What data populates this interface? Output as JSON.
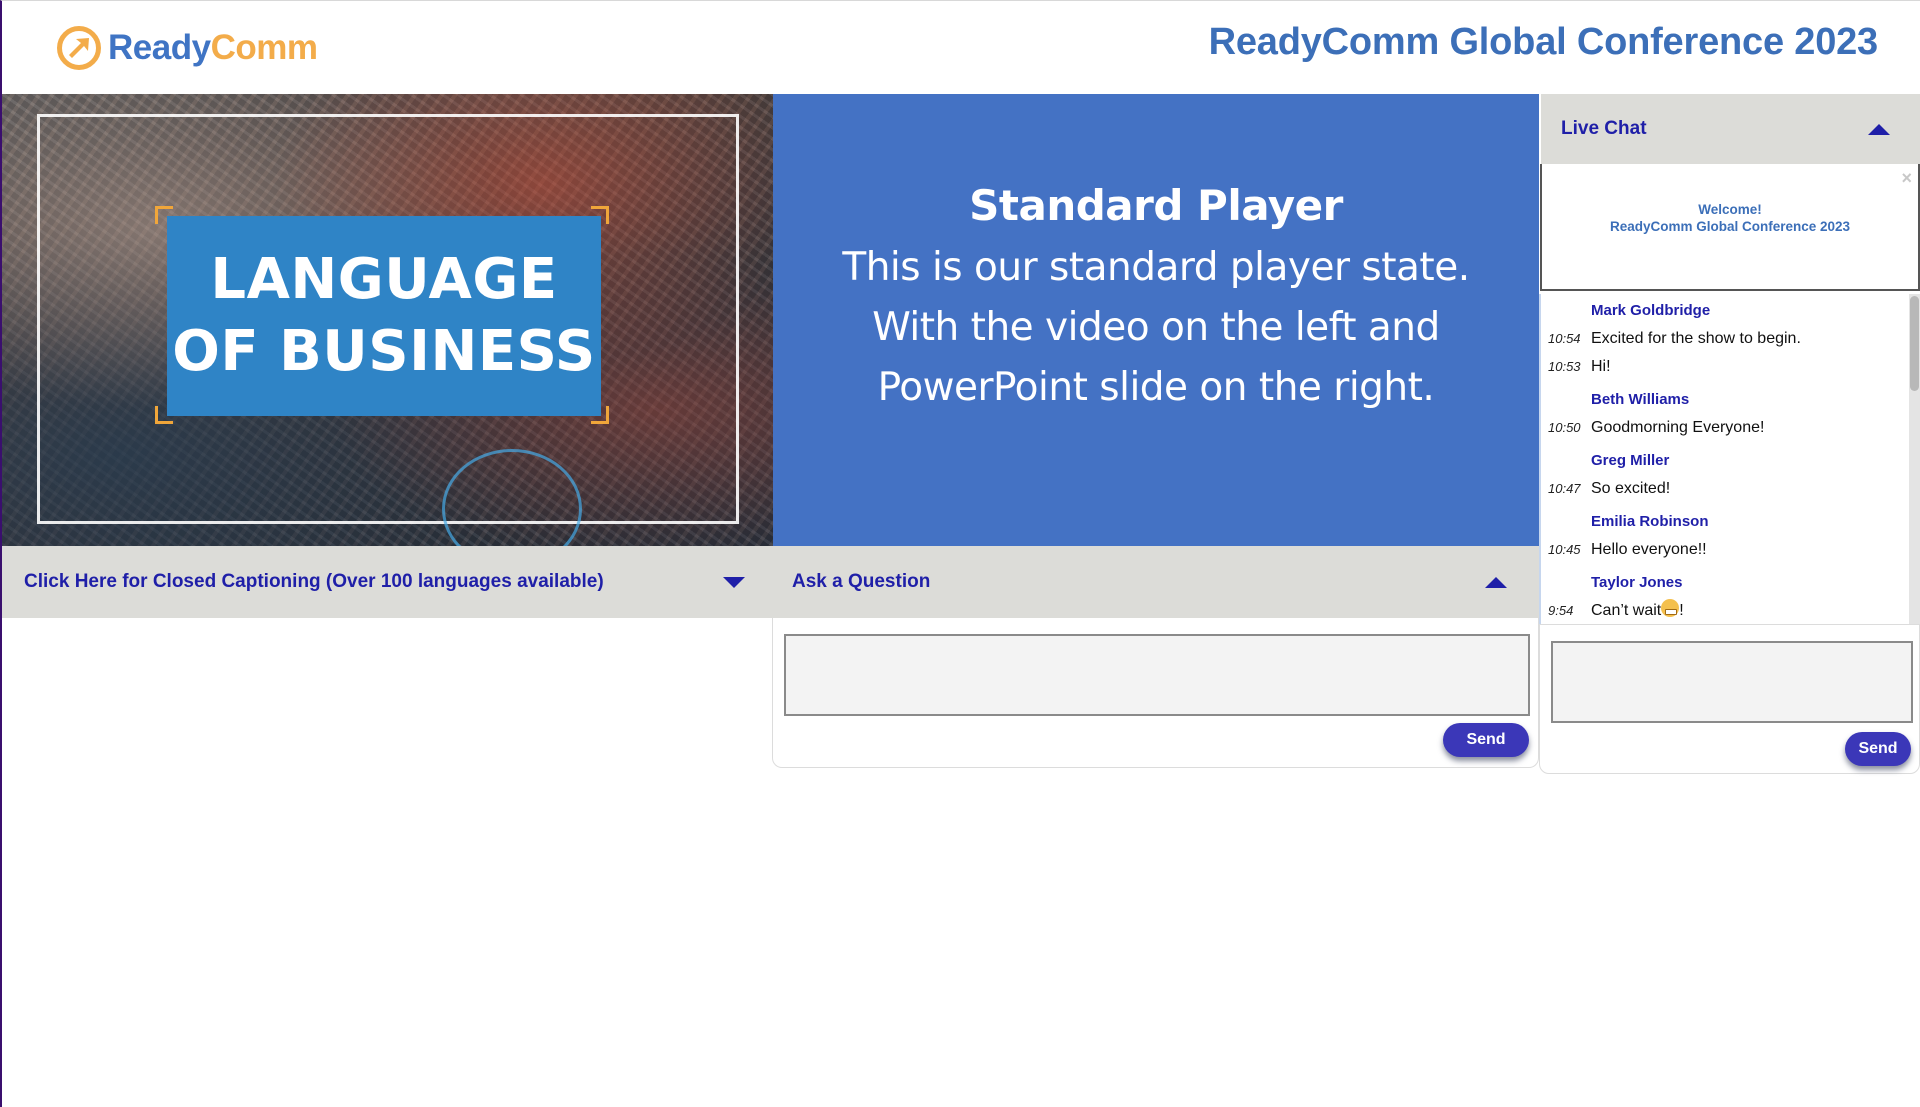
{
  "header": {
    "logo_ready": "Ready",
    "logo_comm": "Comm",
    "conference_title": "ReadyComm Global Conference 2023"
  },
  "video": {
    "title_line1": "LANGUAGE",
    "title_line2": "OF BUSINESS"
  },
  "slide": {
    "title": "Standard Player",
    "body_lines": [
      "This is our standard player state.",
      "With the video on the left and",
      "PowerPoint slide on the right."
    ]
  },
  "captions": {
    "label": "Click Here for Closed Captioning (Over 100 languages available)",
    "toggle_icon": "triangle-down"
  },
  "question": {
    "label": "Ask a Question",
    "toggle_icon": "triangle-up",
    "input_value": "",
    "send_label": "Send"
  },
  "chat": {
    "label": "Live Chat",
    "toggle_icon": "triangle-up",
    "welcome_line1": "Welcome!",
    "welcome_line2": "ReadyComm Global Conference 2023",
    "close_icon": "×",
    "groups": [
      {
        "author": "Mark Goldbridge",
        "messages": [
          {
            "time": "10:54",
            "text": "Excited for the show to begin."
          },
          {
            "time": "10:53",
            "text": "Hi!"
          }
        ]
      },
      {
        "author": "Beth Williams",
        "messages": [
          {
            "time": "10:50",
            "text": "Goodmorning Everyone!"
          }
        ]
      },
      {
        "author": "Greg Miller",
        "messages": [
          {
            "time": "10:47",
            "text": "So excited!"
          }
        ]
      },
      {
        "author": "Emilia Robinson",
        "messages": [
          {
            "time": "10:45",
            "text": "Hello everyone!!"
          }
        ]
      },
      {
        "author": "Taylor Jones",
        "messages": [
          {
            "time": "9:54",
            "text": "Can’t wait",
            "emoji": "grimacing-face",
            "suffix": "!"
          }
        ]
      }
    ],
    "input_value": "",
    "send_label": "Send"
  },
  "colors": {
    "brand_blue": "#3c6fb8",
    "brand_orange": "#f3ac4a",
    "accent_navy": "#1f1fa8",
    "slide_blue": "#4472c4",
    "send_button": "#3b37b8",
    "bar_gray": "#dcdcd8"
  }
}
